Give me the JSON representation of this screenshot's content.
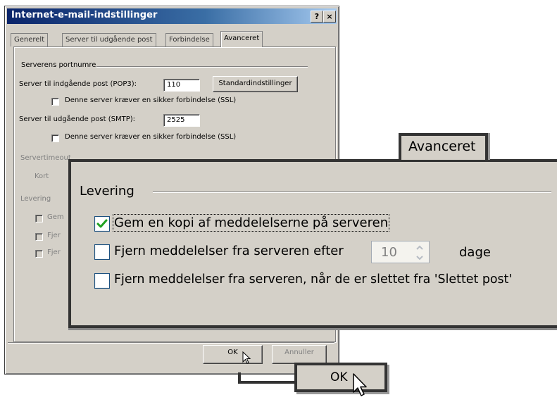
{
  "dialog": {
    "title": "Internet-e-mail-indstillinger",
    "help_button": "?",
    "close_button": "×"
  },
  "tabs": [
    {
      "label": "Generelt",
      "active": false
    },
    {
      "label": "Server til udgående post",
      "active": false
    },
    {
      "label": "Forbindelse",
      "active": false
    },
    {
      "label": "Avanceret",
      "active": true
    }
  ],
  "ports": {
    "group_title": "Serverens portnumre",
    "incoming_label": "Server til indgående post (POP3):",
    "incoming_value": "110",
    "defaults_button": "Standardindstillinger",
    "incoming_ssl_label": "Denne server kræver en sikker forbindelse (SSL)",
    "outgoing_label": "Server til udgående post (SMTP):",
    "outgoing_value": "2525",
    "outgoing_ssl_label": "Denne server kræver en sikker forbindelse (SSL)"
  },
  "timeout": {
    "group_title": "Servertimeout",
    "short_label": "Kort"
  },
  "delivery_bg": {
    "group_title": "Levering",
    "item1": "Gem",
    "item2": "Fjer",
    "item3": "Fjer"
  },
  "buttons": {
    "ok": "OK",
    "cancel": "Annuller"
  },
  "zoom": {
    "tab_label": "Avanceret",
    "group_title": "Levering",
    "keep_copy_label": "Gem en kopi af meddelelserne på serveren",
    "keep_copy_checked": true,
    "remove_after_label": "Fjern meddelelser fra serveren efter",
    "remove_after_checked": false,
    "remove_after_days": "10",
    "days_unit": "dage",
    "remove_deleted_label": "Fjern meddelelser fra serveren, når de er slettet fra 'Slettet post'",
    "remove_deleted_checked": false,
    "ok_label": "OK"
  },
  "colors": {
    "title_active": "#0a246a",
    "face": "#d4d0c8",
    "check_mark": "#21a121",
    "callout_border": "#333333"
  }
}
